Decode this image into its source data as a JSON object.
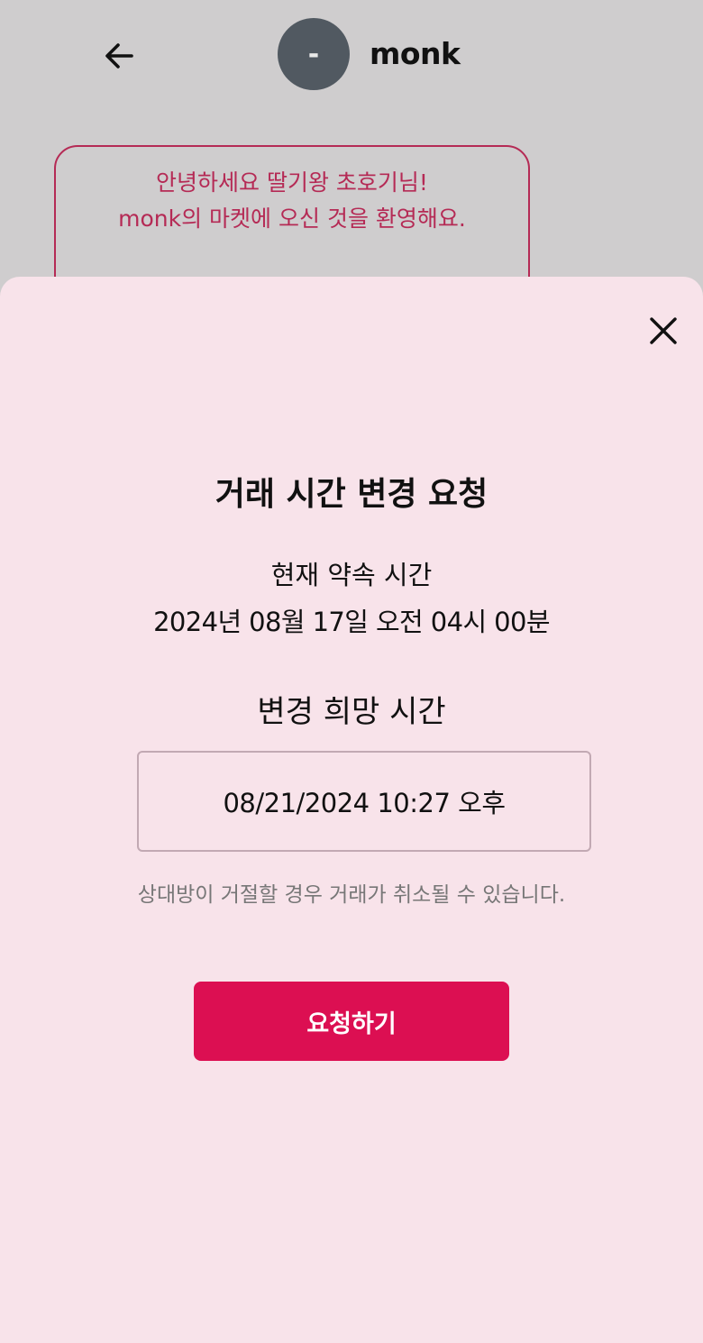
{
  "header": {
    "back_icon": "arrow-left-icon",
    "avatar_text": "-",
    "username": "monk"
  },
  "welcome": {
    "line1": "안녕하세요 딸기왕 초호기님!",
    "line2": "monk의 마켓에 오신 것을 환영해요."
  },
  "modal": {
    "close_icon": "close-icon",
    "title": "거래 시간 변경 요청",
    "current_label": "현재 약속 시간",
    "current_value": "2024년 08월 17일 오전 04시 00분",
    "desired_label": "변경 희망 시간",
    "datetime_value": "08/21/2024 10:27 오후",
    "notice": "상대방이 거절할 경우 거래가 취소될 수 있습니다.",
    "submit_label": "요청하기"
  },
  "colors": {
    "overlay": "#cfcdce",
    "sheet": "#f8e3ea",
    "accent": "#dc0f52",
    "bubble_border": "#b52a55",
    "avatar": "#515961"
  }
}
